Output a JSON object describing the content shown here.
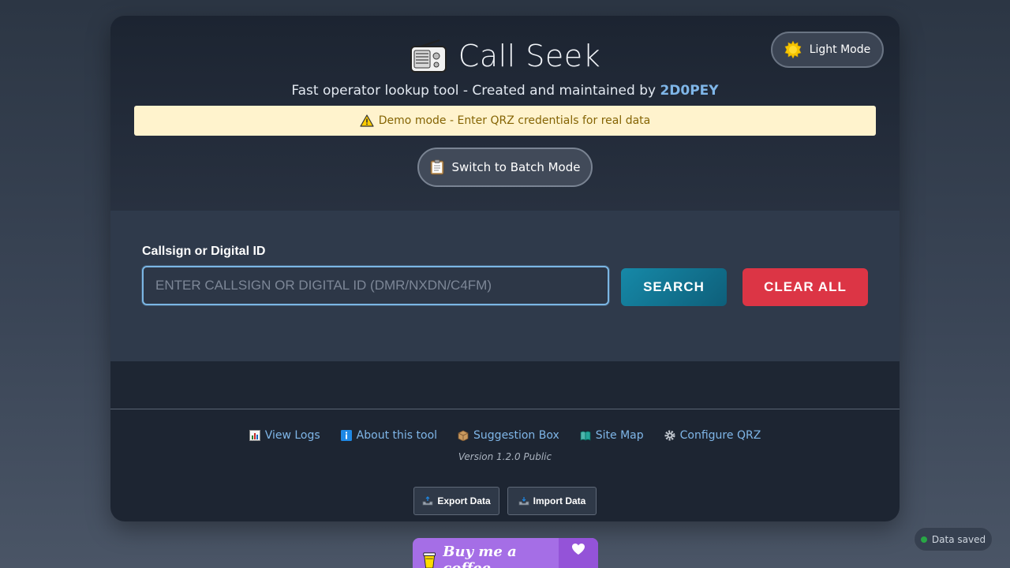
{
  "header": {
    "title": "Call Seek",
    "subtitle_prefix": "Fast operator lookup tool - Created and maintained by ",
    "author": "2D0PEY",
    "theme_toggle_label": "Light Mode",
    "demo_banner": "Demo mode - Enter QRZ credentials for real data",
    "batch_button_label": "Switch to Batch Mode"
  },
  "search": {
    "label": "Callsign or Digital ID",
    "placeholder": "ENTER CALLSIGN OR DIGITAL ID (DMR/NXDN/C4FM)",
    "value": "",
    "search_label": "SEARCH",
    "clear_label": "CLEAR ALL"
  },
  "footer": {
    "links": [
      {
        "label": "View Logs",
        "icon": "bar-chart-icon"
      },
      {
        "label": "About this tool",
        "icon": "info-icon"
      },
      {
        "label": "Suggestion Box",
        "icon": "box-icon"
      },
      {
        "label": "Site Map",
        "icon": "map-icon"
      },
      {
        "label": "Configure QRZ",
        "icon": "gear-icon"
      }
    ],
    "version": "Version 1.2.0 Public",
    "export_label": "Export Data",
    "import_label": "Import Data"
  },
  "status": {
    "saved_label": "Data saved"
  },
  "donate": {
    "label": "Buy me a coffee"
  },
  "colors": {
    "accent": "#7fb6e8",
    "search": "#1689a8",
    "danger": "#dc3545",
    "warning_bg": "#fff3cd",
    "warning_text": "#856404",
    "success": "#28a745",
    "coffee": "#a56ee6"
  }
}
